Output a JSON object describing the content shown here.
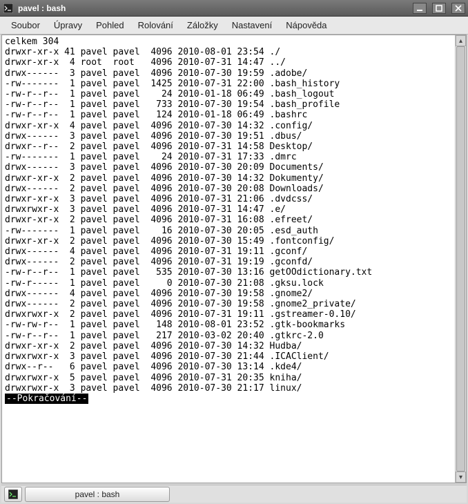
{
  "window": {
    "title": "pavel : bash"
  },
  "menu": {
    "items": [
      "Soubor",
      "Úpravy",
      "Pohled",
      "Rolování",
      "Záložky",
      "Nastavení",
      "Nápověda"
    ]
  },
  "terminal": {
    "summary": "celkem 304",
    "continuation": "--Pokračování--",
    "rows": [
      {
        "perm": "drwxr-xr-x",
        "links": "41",
        "user": "pavel",
        "group": "pavel",
        "size": "4096",
        "date": "2010-08-01",
        "time": "23:54",
        "name": "./"
      },
      {
        "perm": "drwxr-xr-x",
        "links": "4",
        "user": "root",
        "group": "root",
        "size": "4096",
        "date": "2010-07-31",
        "time": "14:47",
        "name": "../"
      },
      {
        "perm": "drwx------",
        "links": "3",
        "user": "pavel",
        "group": "pavel",
        "size": "4096",
        "date": "2010-07-30",
        "time": "19:59",
        "name": ".adobe/"
      },
      {
        "perm": "-rw-------",
        "links": "1",
        "user": "pavel",
        "group": "pavel",
        "size": "1425",
        "date": "2010-07-31",
        "time": "22:00",
        "name": ".bash_history"
      },
      {
        "perm": "-rw-r--r--",
        "links": "1",
        "user": "pavel",
        "group": "pavel",
        "size": "24",
        "date": "2010-01-18",
        "time": "06:49",
        "name": ".bash_logout"
      },
      {
        "perm": "-rw-r--r--",
        "links": "1",
        "user": "pavel",
        "group": "pavel",
        "size": "733",
        "date": "2010-07-30",
        "time": "19:54",
        "name": ".bash_profile"
      },
      {
        "perm": "-rw-r--r--",
        "links": "1",
        "user": "pavel",
        "group": "pavel",
        "size": "124",
        "date": "2010-01-18",
        "time": "06:49",
        "name": ".bashrc"
      },
      {
        "perm": "drwxr-xr-x",
        "links": "4",
        "user": "pavel",
        "group": "pavel",
        "size": "4096",
        "date": "2010-07-30",
        "time": "14:32",
        "name": ".config/"
      },
      {
        "perm": "drwx------",
        "links": "3",
        "user": "pavel",
        "group": "pavel",
        "size": "4096",
        "date": "2010-07-30",
        "time": "19:51",
        "name": ".dbus/"
      },
      {
        "perm": "drwxr--r--",
        "links": "2",
        "user": "pavel",
        "group": "pavel",
        "size": "4096",
        "date": "2010-07-31",
        "time": "14:58",
        "name": "Desktop/"
      },
      {
        "perm": "-rw-------",
        "links": "1",
        "user": "pavel",
        "group": "pavel",
        "size": "24",
        "date": "2010-07-31",
        "time": "17:33",
        "name": ".dmrc"
      },
      {
        "perm": "drwx------",
        "links": "3",
        "user": "pavel",
        "group": "pavel",
        "size": "4096",
        "date": "2010-07-30",
        "time": "20:09",
        "name": "Documents/"
      },
      {
        "perm": "drwxr-xr-x",
        "links": "2",
        "user": "pavel",
        "group": "pavel",
        "size": "4096",
        "date": "2010-07-30",
        "time": "14:32",
        "name": "Dokumenty/"
      },
      {
        "perm": "drwx------",
        "links": "2",
        "user": "pavel",
        "group": "pavel",
        "size": "4096",
        "date": "2010-07-30",
        "time": "20:08",
        "name": "Downloads/"
      },
      {
        "perm": "drwxr-xr-x",
        "links": "3",
        "user": "pavel",
        "group": "pavel",
        "size": "4096",
        "date": "2010-07-31",
        "time": "21:06",
        "name": ".dvdcss/"
      },
      {
        "perm": "drwxrwxr-x",
        "links": "3",
        "user": "pavel",
        "group": "pavel",
        "size": "4096",
        "date": "2010-07-31",
        "time": "14:47",
        "name": ".e/"
      },
      {
        "perm": "drwxr-xr-x",
        "links": "2",
        "user": "pavel",
        "group": "pavel",
        "size": "4096",
        "date": "2010-07-31",
        "time": "16:08",
        "name": ".efreet/"
      },
      {
        "perm": "-rw-------",
        "links": "1",
        "user": "pavel",
        "group": "pavel",
        "size": "16",
        "date": "2010-07-30",
        "time": "20:05",
        "name": ".esd_auth"
      },
      {
        "perm": "drwxr-xr-x",
        "links": "2",
        "user": "pavel",
        "group": "pavel",
        "size": "4096",
        "date": "2010-07-30",
        "time": "15:49",
        "name": ".fontconfig/"
      },
      {
        "perm": "drwx------",
        "links": "4",
        "user": "pavel",
        "group": "pavel",
        "size": "4096",
        "date": "2010-07-31",
        "time": "19:11",
        "name": ".gconf/"
      },
      {
        "perm": "drwx------",
        "links": "2",
        "user": "pavel",
        "group": "pavel",
        "size": "4096",
        "date": "2010-07-31",
        "time": "19:19",
        "name": ".gconfd/"
      },
      {
        "perm": "-rw-r--r--",
        "links": "1",
        "user": "pavel",
        "group": "pavel",
        "size": "535",
        "date": "2010-07-30",
        "time": "13:16",
        "name": "getOOdictionary.txt"
      },
      {
        "perm": "-rw-r-----",
        "links": "1",
        "user": "pavel",
        "group": "pavel",
        "size": "0",
        "date": "2010-07-30",
        "time": "21:08",
        "name": ".gksu.lock"
      },
      {
        "perm": "drwx------",
        "links": "4",
        "user": "pavel",
        "group": "pavel",
        "size": "4096",
        "date": "2010-07-30",
        "time": "19:58",
        "name": ".gnome2/"
      },
      {
        "perm": "drwx------",
        "links": "2",
        "user": "pavel",
        "group": "pavel",
        "size": "4096",
        "date": "2010-07-30",
        "time": "19:58",
        "name": ".gnome2_private/"
      },
      {
        "perm": "drwxrwxr-x",
        "links": "2",
        "user": "pavel",
        "group": "pavel",
        "size": "4096",
        "date": "2010-07-31",
        "time": "19:11",
        "name": ".gstreamer-0.10/"
      },
      {
        "perm": "-rw-rw-r--",
        "links": "1",
        "user": "pavel",
        "group": "pavel",
        "size": "148",
        "date": "2010-08-01",
        "time": "23:52",
        "name": ".gtk-bookmarks"
      },
      {
        "perm": "-rw-r--r--",
        "links": "1",
        "user": "pavel",
        "group": "pavel",
        "size": "217",
        "date": "2010-03-02",
        "time": "20:40",
        "name": ".gtkrc-2.0"
      },
      {
        "perm": "drwxr-xr-x",
        "links": "2",
        "user": "pavel",
        "group": "pavel",
        "size": "4096",
        "date": "2010-07-30",
        "time": "14:32",
        "name": "Hudba/"
      },
      {
        "perm": "drwxrwxr-x",
        "links": "3",
        "user": "pavel",
        "group": "pavel",
        "size": "4096",
        "date": "2010-07-30",
        "time": "21:44",
        "name": ".ICAClient/"
      },
      {
        "perm": "drwx--r--",
        "links": "6",
        "user": "pavel",
        "group": "pavel",
        "size": "4096",
        "date": "2010-07-30",
        "time": "13:14",
        "name": ".kde4/"
      },
      {
        "perm": "drwxrwxr-x",
        "links": "5",
        "user": "pavel",
        "group": "pavel",
        "size": "4096",
        "date": "2010-07-31",
        "time": "20:35",
        "name": "kniha/"
      },
      {
        "perm": "drwxrwxr-x",
        "links": "3",
        "user": "pavel",
        "group": "pavel",
        "size": "4096",
        "date": "2010-07-30",
        "time": "21:17",
        "name": "linux/"
      }
    ]
  },
  "taskbar": {
    "tab": "pavel : bash"
  }
}
